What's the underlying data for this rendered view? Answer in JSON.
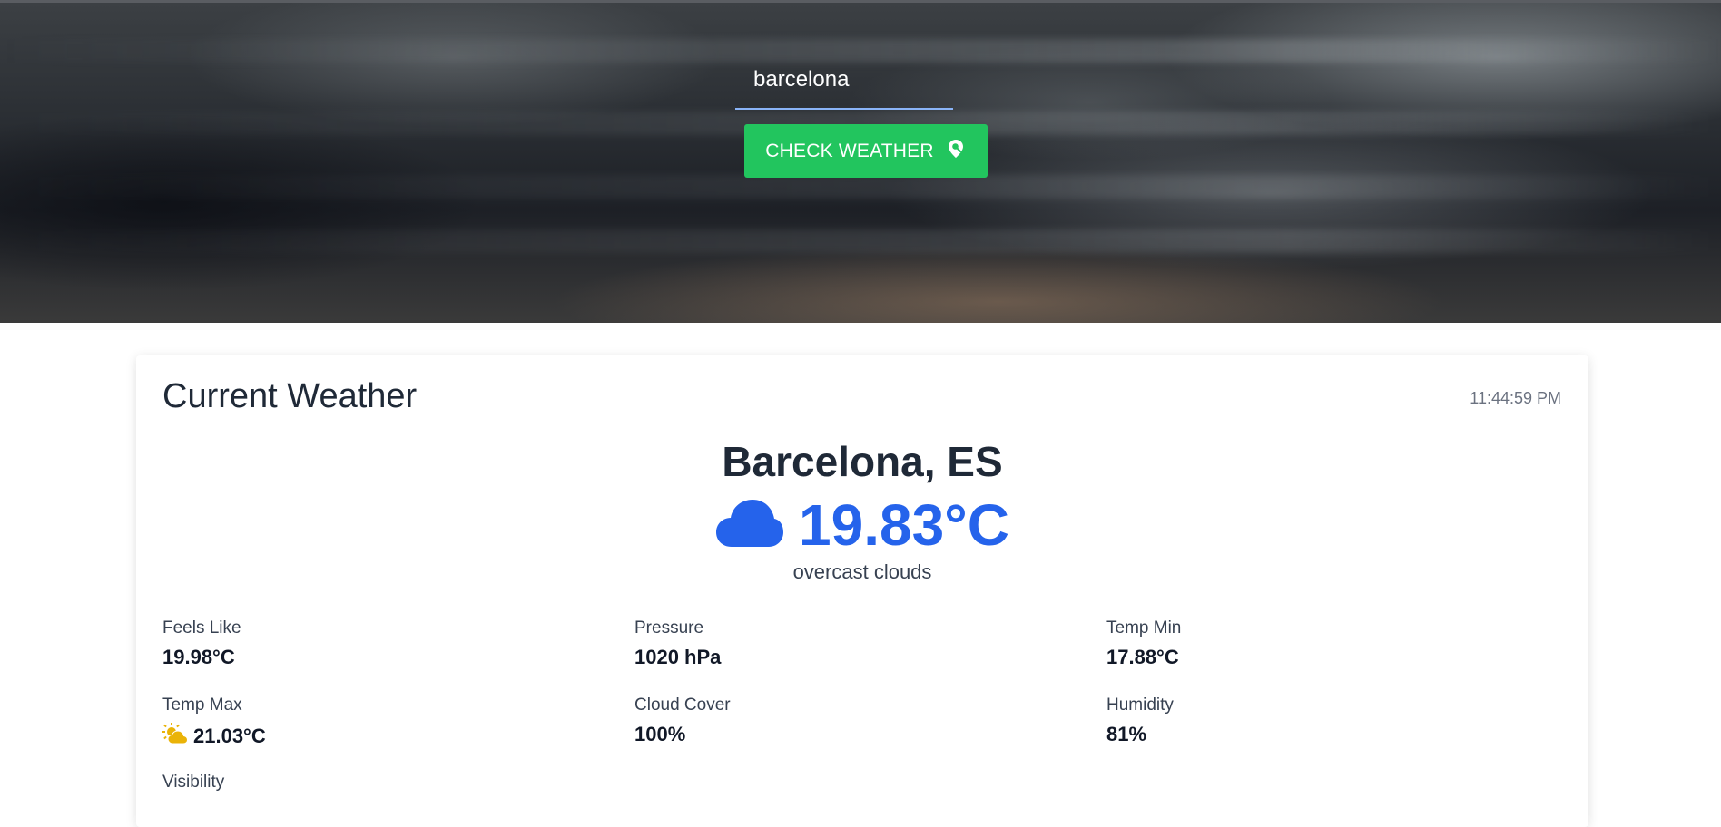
{
  "search": {
    "value": "barcelona"
  },
  "check_button": {
    "label": "CHECK WEATHER",
    "icon": "map-pin-search-icon",
    "color": "#22c55e"
  },
  "card": {
    "title": "Current Weather",
    "timestamp": "11:44:59 PM",
    "city": "Barcelona, ES",
    "temperature": "19.83°C",
    "condition_icon": "cloud-icon",
    "description": "overcast clouds",
    "accent_color": "#2563eb"
  },
  "stats": {
    "feels_like": {
      "label": "Feels Like",
      "value": "19.98°C"
    },
    "pressure": {
      "label": "Pressure",
      "value": "1020 hPa"
    },
    "temp_min": {
      "label": "Temp Min",
      "value": "17.88°C"
    },
    "temp_max": {
      "label": "Temp Max",
      "value": "21.03°C",
      "icon": "sun-behind-cloud-icon"
    },
    "cloud_cover": {
      "label": "Cloud Cover",
      "value": "100%"
    },
    "humidity": {
      "label": "Humidity",
      "value": "81%"
    },
    "visibility": {
      "label": "Visibility"
    }
  }
}
